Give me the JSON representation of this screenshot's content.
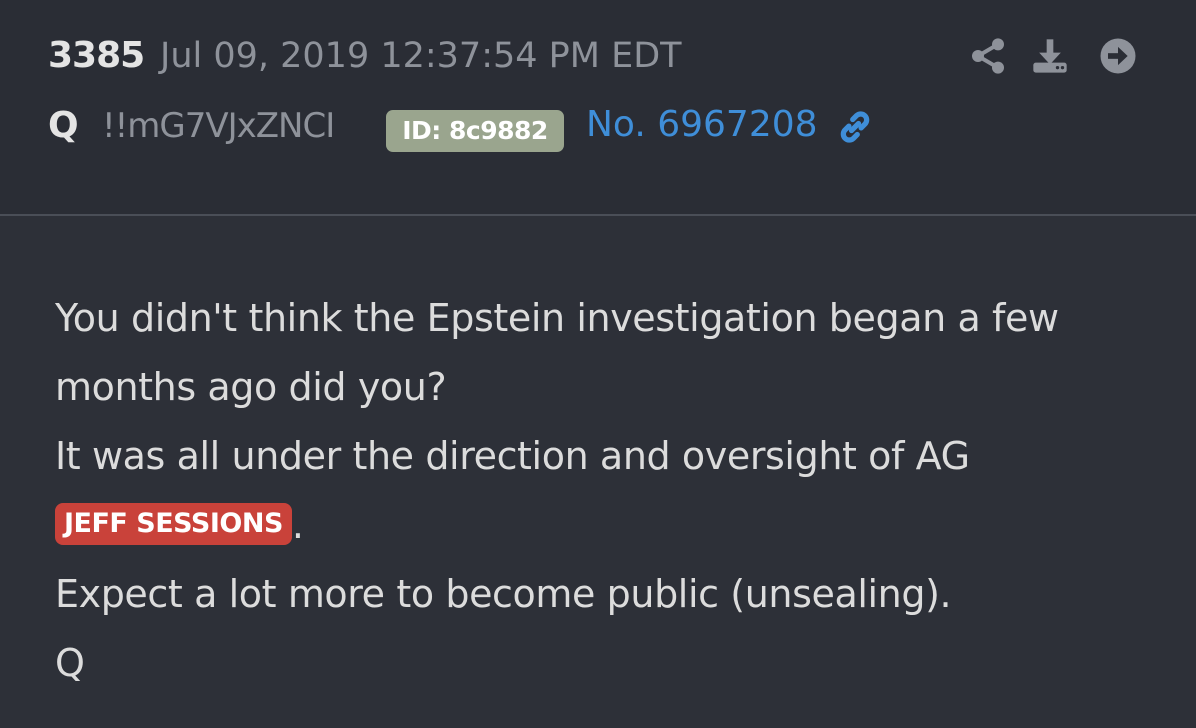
{
  "post": {
    "number": "3385",
    "timestamp": "Jul 09, 2019 12:37:54 PM EDT",
    "author": "Q",
    "tripcode": "!!mG7VJxZNCI",
    "id_badge": "ID: 8c9882",
    "post_link": "No. 6967208"
  },
  "actions": {
    "icons": [
      "share-icon",
      "download-icon",
      "arrow-circle-right-icon"
    ]
  },
  "body": {
    "line1": "You didn't think the Epstein investigation began a few",
    "line2": "months ago did you?",
    "line3": "It was all under the direction and oversight of AG",
    "tag": "JEFF SESSIONS",
    "tag_suffix": ".",
    "line5": "Expect a lot more to become public (unsealing).",
    "signature": "Q"
  },
  "colors": {
    "background": "#2d3038",
    "header_background": "#2a2d35",
    "link": "#3f8ed8",
    "id_badge": "#9aa58e",
    "tag": "#c9423a",
    "icon": "#8e929a"
  }
}
